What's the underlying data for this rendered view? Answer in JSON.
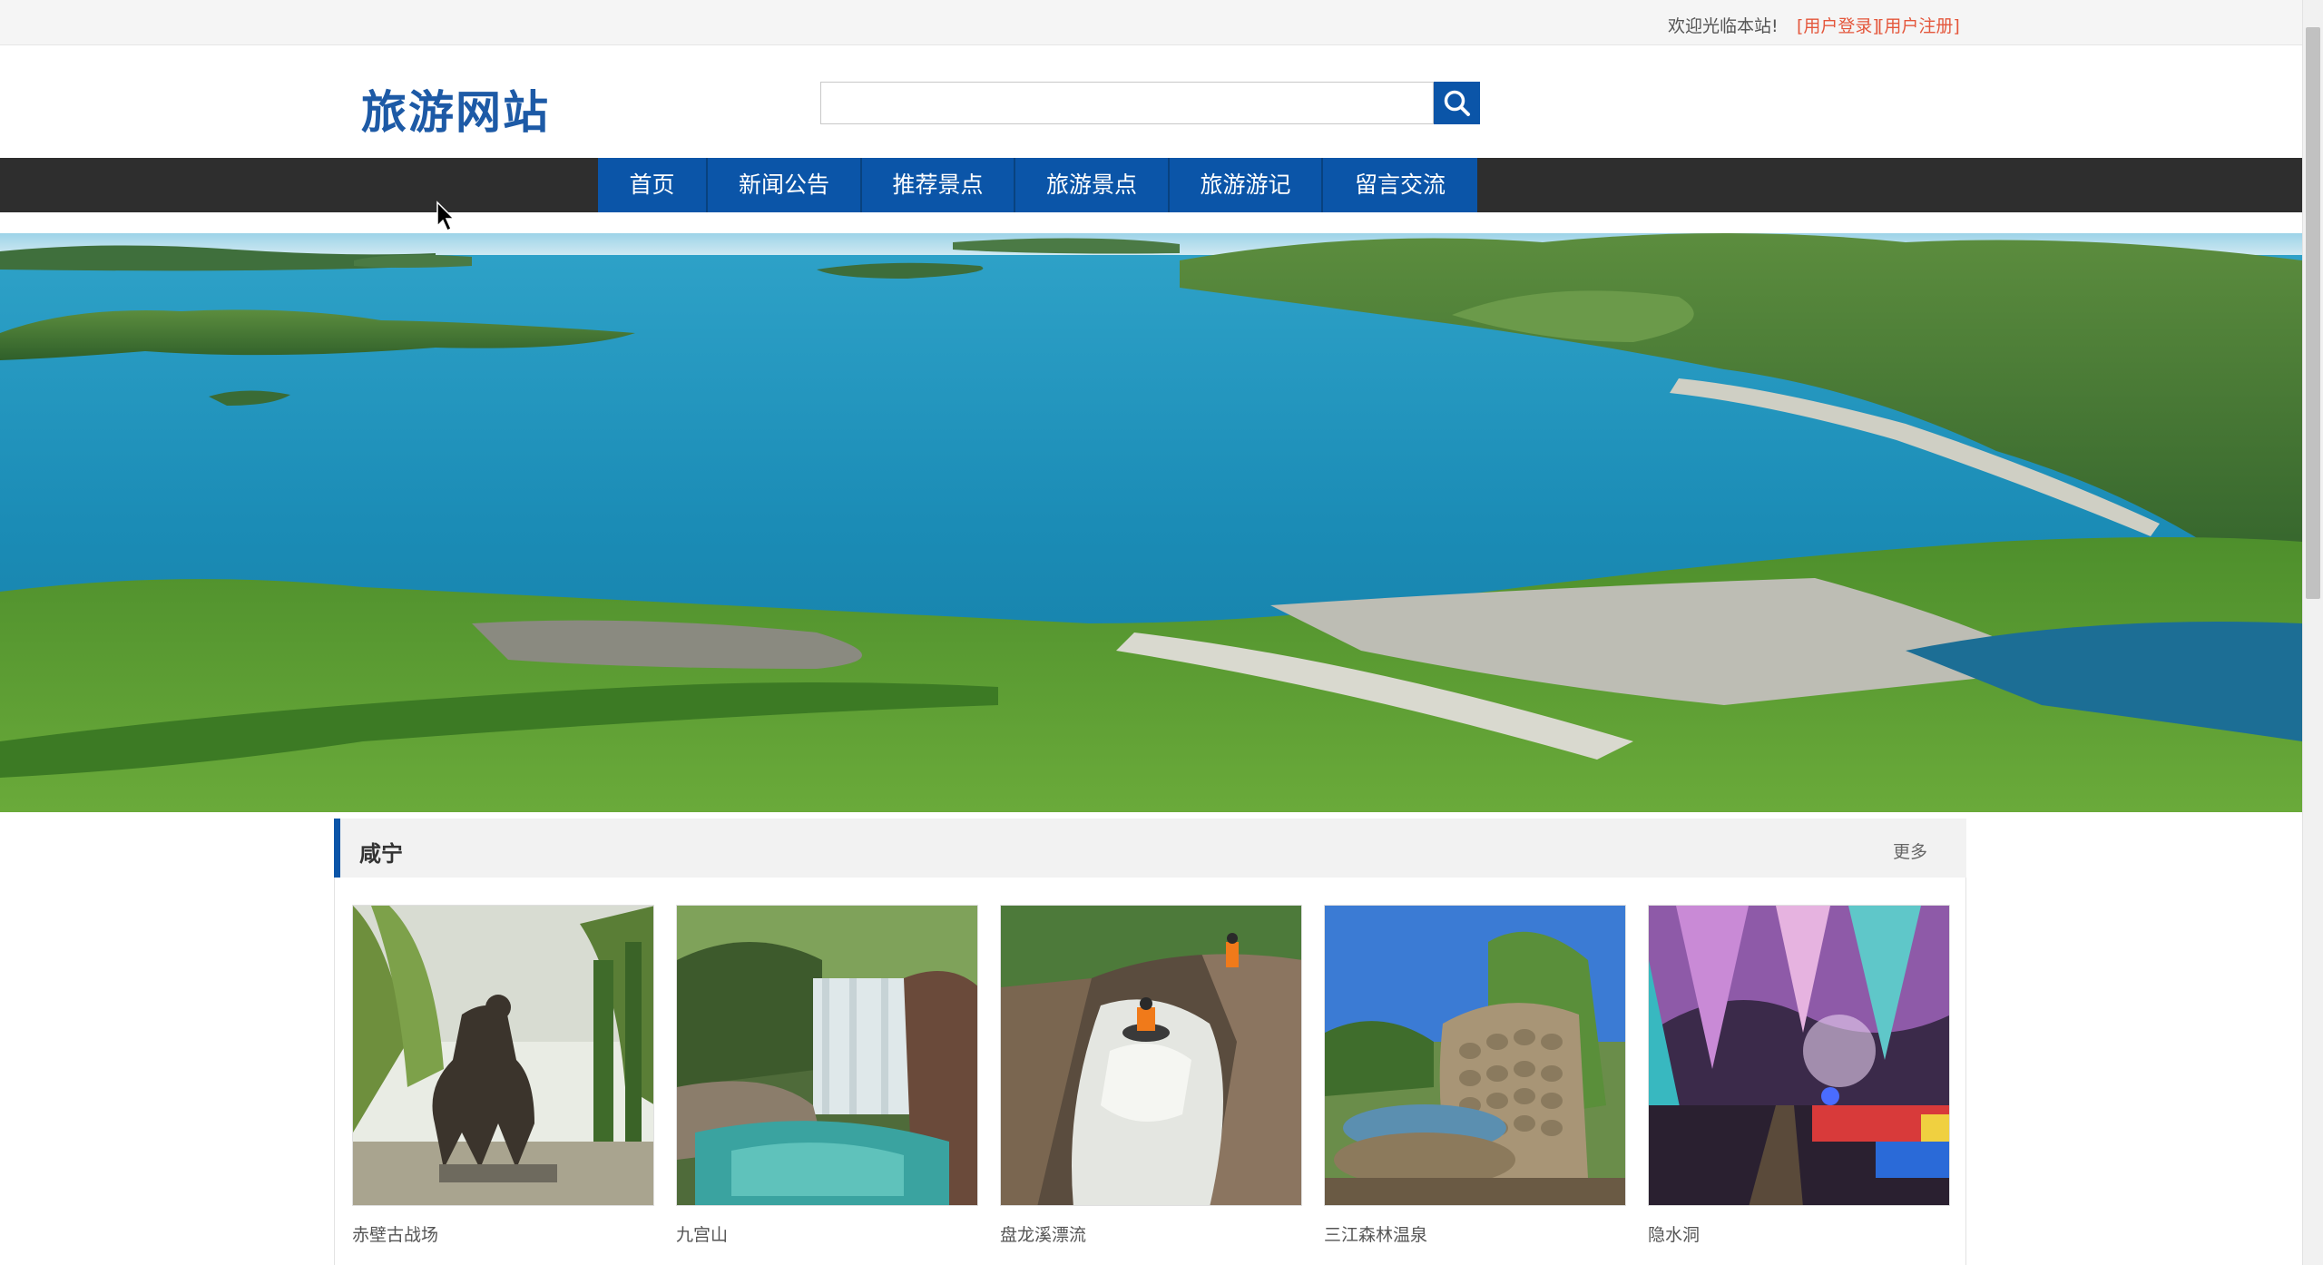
{
  "topbar": {
    "welcome": "欢迎光临本站!",
    "login": "[用户登录]",
    "register": "[用户注册]"
  },
  "logo": {
    "text": "旅游网站"
  },
  "search": {
    "placeholder": "",
    "button_icon": "search-icon"
  },
  "nav": {
    "items": [
      {
        "label": "首页"
      },
      {
        "label": "新闻公告"
      },
      {
        "label": "推荐景点"
      },
      {
        "label": "旅游景点"
      },
      {
        "label": "旅游游记"
      },
      {
        "label": "留言交流"
      }
    ]
  },
  "banner": {
    "image": "aerial lake reservoir with green hills and dam",
    "slide_count": 4,
    "active_slide": 1
  },
  "section": {
    "title": "咸宁",
    "more": "更多",
    "cards": [
      {
        "label": "赤壁古战场",
        "image": "bronze horse statue among willow trees"
      },
      {
        "label": "九宫山",
        "image": "waterfall into green pool"
      },
      {
        "label": "盘龙溪漂流",
        "image": "river rafting in rocky gorge"
      },
      {
        "label": "三江森林温泉",
        "image": "stone wall with hot spring pool"
      },
      {
        "label": "隐水洞",
        "image": "colorful lit cave with train"
      }
    ]
  },
  "colors": {
    "brand_blue": "#0b55a8",
    "nav_dark": "#2e2e2e",
    "link_red": "#e4573c",
    "dot_active": "#4a9a1c"
  }
}
